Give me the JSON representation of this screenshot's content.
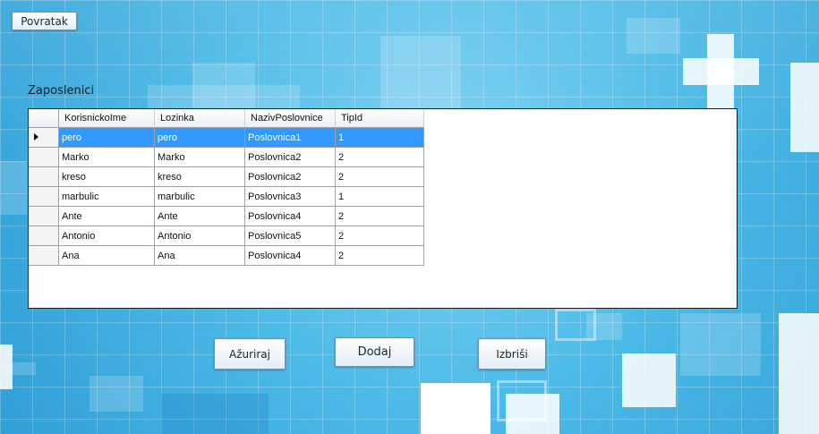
{
  "toolbar": {
    "back_label": "Povratak"
  },
  "section": {
    "title": "Zaposlenici"
  },
  "table": {
    "columns": [
      "KorisnickoIme",
      "Lozinka",
      "NazivPoslovnice",
      "TipId"
    ],
    "rows": [
      [
        "pero",
        "pero",
        "Poslovnica1",
        "1"
      ],
      [
        "Marko",
        "Marko",
        "Poslovnica2",
        "2"
      ],
      [
        "kreso",
        "kreso",
        "Poslovnica2",
        "2"
      ],
      [
        "marbulic",
        "marbulic",
        "Poslovnica3",
        "1"
      ],
      [
        "Ante",
        "Ante",
        "Poslovnica4",
        "2"
      ],
      [
        "Antonio",
        "Antonio",
        "Poslovnica5",
        "2"
      ],
      [
        "Ana",
        "Ana",
        "Poslovnica4",
        "2"
      ]
    ],
    "selected_row": 0
  },
  "actions": {
    "update_label": "Ažuriraj",
    "add_label": "Dodaj",
    "delete_label": "Izbriši"
  },
  "icons": {
    "current_row": "current-row-arrow-icon"
  }
}
